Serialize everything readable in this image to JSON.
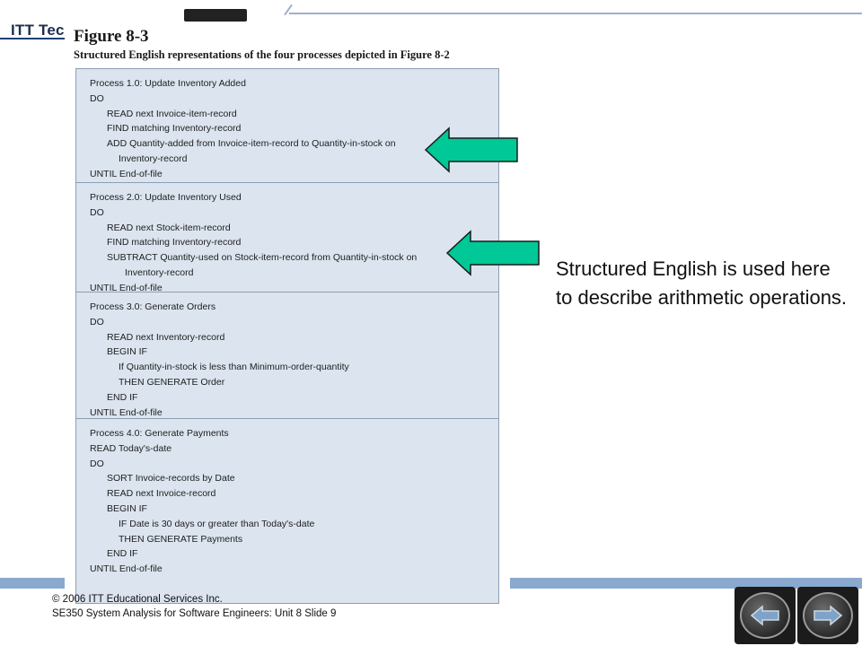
{
  "header": {
    "logo_text": "ITT Tec"
  },
  "figure": {
    "title": "Figure 8-3",
    "caption": "Structured English representations of the four processes depicted in Figure 8-2",
    "processes": [
      {
        "lines": [
          {
            "indent": 0,
            "text": "Process 1.0: Update Inventory Added"
          },
          {
            "indent": 0,
            "text": "DO"
          },
          {
            "indent": 1,
            "text": "READ next Invoice-item-record"
          },
          {
            "indent": 1,
            "text": "FIND matching Inventory-record"
          },
          {
            "indent": 1,
            "text": "ADD Quantity-added from Invoice-item-record to Quantity-in-stock on"
          },
          {
            "indent": 2,
            "text": "Inventory-record"
          },
          {
            "indent": 0,
            "text": "UNTIL End-of-file"
          }
        ]
      },
      {
        "lines": [
          {
            "indent": 0,
            "text": "Process 2.0: Update Inventory Used"
          },
          {
            "indent": 0,
            "text": "DO"
          },
          {
            "indent": 1,
            "text": "READ next Stock-item-record"
          },
          {
            "indent": 1,
            "text": "FIND matching Inventory-record"
          },
          {
            "indent": 1,
            "text": "SUBTRACT Quantity-used on Stock-item-record from Quantity-in-stock on"
          },
          {
            "indent": 3,
            "text": "Inventory-record"
          },
          {
            "indent": 0,
            "text": "UNTIL End-of-file"
          }
        ]
      },
      {
        "lines": [
          {
            "indent": 0,
            "text": "Process 3.0: Generate Orders"
          },
          {
            "indent": 0,
            "text": "DO"
          },
          {
            "indent": 1,
            "text": "READ next Inventory-record"
          },
          {
            "indent": 1,
            "text": "BEGIN IF"
          },
          {
            "indent": 2,
            "text": "If Quantity-in-stock is less than Minimum-order-quantity"
          },
          {
            "indent": 2,
            "text": "THEN GENERATE Order"
          },
          {
            "indent": 1,
            "text": "END IF"
          },
          {
            "indent": 0,
            "text": "UNTIL End-of-file"
          }
        ]
      },
      {
        "lines": [
          {
            "indent": 0,
            "text": "Process 4.0: Generate Payments"
          },
          {
            "indent": 0,
            "text": "READ Today's-date"
          },
          {
            "indent": 0,
            "text": "DO"
          },
          {
            "indent": 1,
            "text": "SORT Invoice-records by Date"
          },
          {
            "indent": 1,
            "text": "READ next Invoice-record"
          },
          {
            "indent": 1,
            "text": "BEGIN IF"
          },
          {
            "indent": 2,
            "text": "IF Date is 30 days or greater than Today's-date"
          },
          {
            "indent": 2,
            "text": "THEN GENERATE Payments"
          },
          {
            "indent": 1,
            "text": "END IF"
          },
          {
            "indent": 0,
            "text": "UNTIL End-of-file"
          }
        ]
      }
    ]
  },
  "note": {
    "text": "Structured English is used here to describe arithmetic operations."
  },
  "footer": {
    "copyright": "© 2006 ITT Educational Services Inc.",
    "course": "SE350 System Analysis for Software Engineers: Unit 8 Slide 9"
  },
  "icons": {
    "prev": "arrow-left-icon",
    "next": "arrow-right-icon"
  },
  "colors": {
    "arrow_fill": "#00c896",
    "box_fill": "#dbe4ef",
    "footer_band": "#8aa9cf"
  }
}
